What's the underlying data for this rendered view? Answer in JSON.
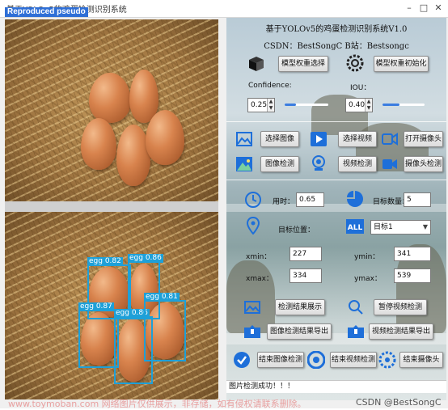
{
  "window": {
    "title": "基于YOLOv5的鸡蛋检测识别系统",
    "badge": "Reproduced pseudo"
  },
  "app": {
    "title": "基于YOLOv5的鸡蛋检测识别系统V1.0",
    "subtitle": "CSDN：BestSongC   B站：Bestsongc"
  },
  "model": {
    "select_label": "模型权重选择",
    "init_label": "模型权重初始化"
  },
  "params": {
    "confidence_label": "Confidence:",
    "confidence_value": "0.25",
    "confidence_level": 0.25,
    "iou_label": "IOU：",
    "iou_value": "0.40",
    "iou_level": 0.4
  },
  "actions": {
    "select_image": "选择图像",
    "select_video": "选择视频",
    "open_camera": "打开摄像头",
    "image_detect": "图像检测",
    "video_detect": "视频检测",
    "camera_detect": "摄像头检测"
  },
  "results": {
    "time_label": "用时：",
    "time_value": "0.65",
    "count_label": "目标数量：",
    "count_value": "5",
    "position_label": "目标位置：",
    "target_select": "目标1",
    "xmin_label": "xmin：",
    "xmin_value": "227",
    "ymin_label": "ymin：",
    "ymin_value": "341",
    "xmax_label": "xmax：",
    "xmax_value": "334",
    "ymax_label": "ymax：",
    "ymax_value": "539"
  },
  "controls": {
    "show_result": "检测结果展示",
    "pause_video": "暂停视频检测",
    "export_image": "图像检测结果导出",
    "export_video": "视频检测结果导出",
    "end_image": "结束图像检测",
    "end_video": "结束视频检测",
    "end_camera": "结束摄像头"
  },
  "detections": [
    {
      "label": "egg 0.82"
    },
    {
      "label": "egg 0.86"
    },
    {
      "label": "egg 0.87"
    },
    {
      "label": "egg 0.86"
    },
    {
      "label": "egg 0.81"
    }
  ],
  "status": {
    "message": "图片检测成功！！！"
  },
  "footer": {
    "watermark": "www.toymoban.com 网络图片仅供展示，非存储，如有侵权请联系删除。",
    "credit": "CSDN @BestSongC"
  },
  "colors": {
    "accent_blue": "#3b7de0",
    "detect_box": "#1ea0d8",
    "icon_blue": "#1e6fd9"
  },
  "icons": [
    "cube-icon",
    "gear-icon",
    "image-icon",
    "play-icon",
    "camera-icon",
    "landscape-icon",
    "webcam-icon",
    "clock-icon",
    "pie-chart-icon",
    "location-icon",
    "all-icon",
    "image-icon",
    "search-icon",
    "export-icon",
    "check-icon",
    "stop-icon"
  ]
}
